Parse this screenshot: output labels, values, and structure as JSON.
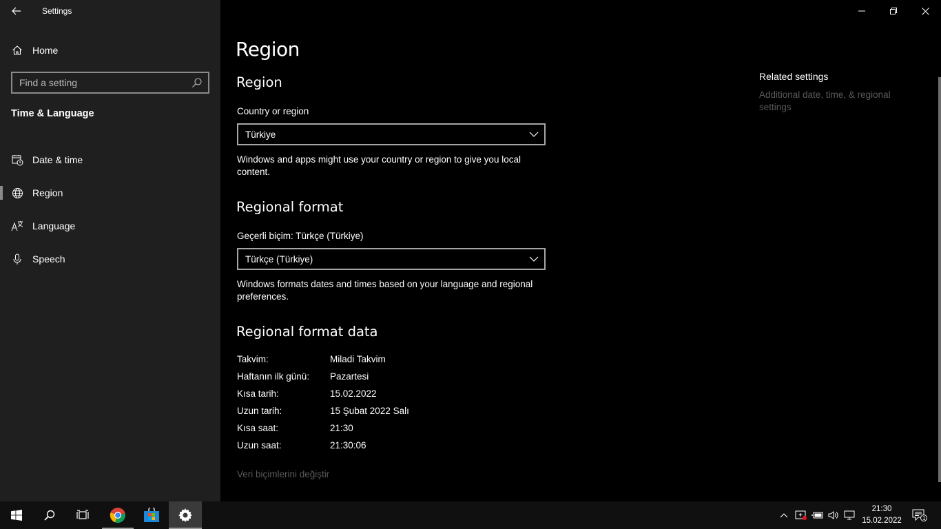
{
  "window": {
    "title": "Settings"
  },
  "sidebar": {
    "home_label": "Home",
    "search_placeholder": "Find a setting",
    "section_title": "Time & Language",
    "items": [
      {
        "label": "Date & time",
        "icon": "calendar-clock-icon",
        "active": false
      },
      {
        "label": "Region",
        "icon": "globe-icon",
        "active": true
      },
      {
        "label": "Language",
        "icon": "language-icon",
        "active": false
      },
      {
        "label": "Speech",
        "icon": "microphone-icon",
        "active": false
      }
    ]
  },
  "main": {
    "page_title": "Region",
    "region": {
      "heading": "Region",
      "country_label": "Country or region",
      "country_value": "Türkiye",
      "country_desc": "Windows and apps might use your country or region to give you local content."
    },
    "format": {
      "heading": "Regional format",
      "current_label": "Geçerli biçim: Türkçe (Türkiye)",
      "format_value": "Türkçe (Türkiye)",
      "format_desc": "Windows formats dates and times based on your language and regional preferences."
    },
    "format_data": {
      "heading": "Regional format data",
      "rows": [
        {
          "key": "Takvim:",
          "value": "Miladi Takvim"
        },
        {
          "key": "Haftanın ilk günü:",
          "value": "Pazartesi"
        },
        {
          "key": "Kısa tarih:",
          "value": "15.02.2022"
        },
        {
          "key": "Uzun tarih:",
          "value": "15 Şubat 2022 Salı"
        },
        {
          "key": "Kısa saat:",
          "value": "21:30"
        },
        {
          "key": "Uzun saat:",
          "value": "21:30:06"
        }
      ],
      "change_link": "Veri biçimlerini değiştir"
    },
    "related": {
      "title": "Related settings",
      "link": "Additional date, time, & regional settings"
    }
  },
  "taskbar": {
    "time": "21:30",
    "date": "15.02.2022",
    "notification_count": "1",
    "apps": [
      "start-icon",
      "search-icon",
      "task-view-icon",
      "chrome-icon",
      "store-icon",
      "settings-gear-icon"
    ]
  },
  "colors": {
    "sidebar_bg": "#1f1f1f",
    "main_bg": "#000000",
    "taskbar_bg": "#101010",
    "disabled_text": "#5a5a5a"
  }
}
